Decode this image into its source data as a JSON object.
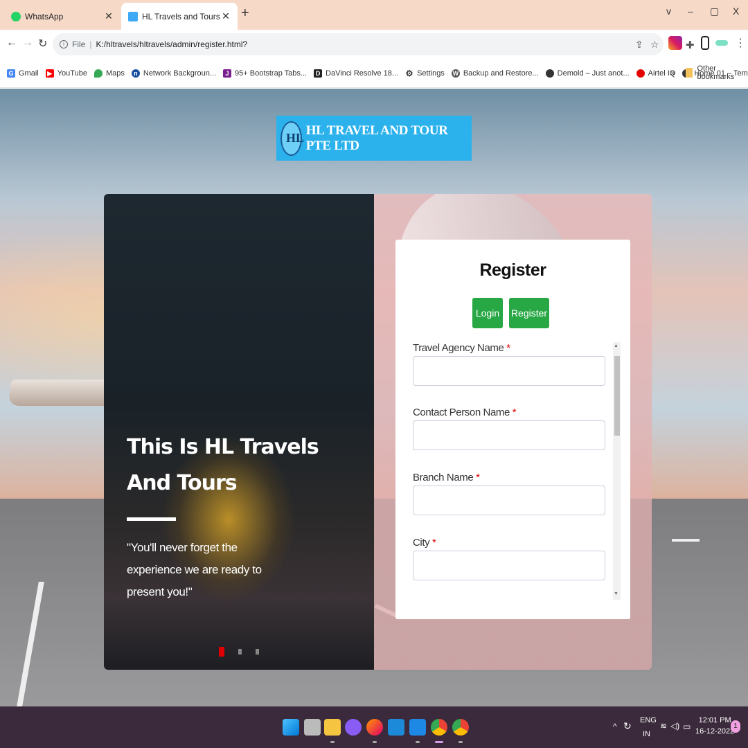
{
  "browser": {
    "tabs": [
      {
        "label": "WhatsApp",
        "active": false
      },
      {
        "label": "HL Travels and Tours",
        "active": true
      }
    ],
    "window_controls": {
      "minimize": "–",
      "restore": "▢",
      "close": "X",
      "dropdown": "v"
    },
    "address": {
      "scheme": "File",
      "url": "K:/hltravels/hltravels/admin/register.html?"
    },
    "bookmarks": [
      {
        "label": "Gmail",
        "icon": "google-icon",
        "color": "#4285f4"
      },
      {
        "label": "YouTube",
        "icon": "youtube-icon",
        "color": "#ff0000"
      },
      {
        "label": "Maps",
        "icon": "maps-pin-icon",
        "color": "#34a853"
      },
      {
        "label": "Network Backgroun...",
        "icon": "network-icon",
        "color": "#1a4fa0"
      },
      {
        "label": "95+ Bootstrap Tabs...",
        "icon": "jr-icon",
        "color": "#7a1f8e"
      },
      {
        "label": "DaVinci Resolve 18...",
        "icon": "davinci-icon",
        "color": "#222222"
      },
      {
        "label": "Settings",
        "icon": "gear-icon",
        "color": "#333333"
      },
      {
        "label": "Backup and Restore...",
        "icon": "wordpress-icon",
        "color": "#555555"
      },
      {
        "label": "Demold – Just anot...",
        "icon": "globe-icon",
        "color": "#333333"
      },
      {
        "label": "Airtel IQ",
        "icon": "airtel-icon",
        "color": "#e40000"
      },
      {
        "label": "Home 01 – Templat...",
        "icon": "globe-icon",
        "color": "#333333"
      }
    ],
    "bookmarks_overflow": "»",
    "other_bookmarks": "Other bookmarks"
  },
  "page": {
    "logo_text": "HL TRAVEL AND TOUR PTE LTD",
    "logo_mark": "HL",
    "hero": {
      "title": "This Is HL Travels And Tours",
      "quote": "\"You'll never forget the experience we are ready to present you!\""
    },
    "form": {
      "title": "Register",
      "login_button": "Login",
      "register_button": "Register",
      "fields": [
        {
          "label": "Travel Agency Name",
          "required_mark": "*",
          "value": ""
        },
        {
          "label": "Contact Person Name",
          "required_mark": "*",
          "value": ""
        },
        {
          "label": "Branch Name",
          "required_mark": "*",
          "value": ""
        },
        {
          "label": "City",
          "required_mark": "*",
          "value": ""
        }
      ]
    }
  },
  "taskbar": {
    "language": "ENG",
    "region": "IN",
    "time": "12:01 PM",
    "date": "16-12-2022",
    "notifications": "1"
  }
}
